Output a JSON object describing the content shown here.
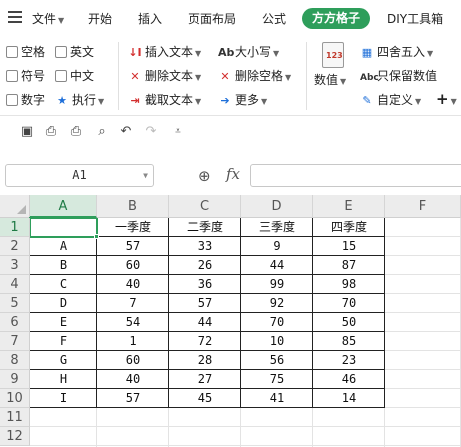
{
  "menu": {
    "file": "文件",
    "items": [
      "开始",
      "插入",
      "页面布局",
      "公式",
      "方方格子",
      "DIY工具箱"
    ]
  },
  "ribbon": {
    "checkboxes": [
      "空格",
      "英文",
      "符号",
      "中文",
      "数字"
    ],
    "execute": "执行",
    "text_tools": [
      "插入文本",
      "删除文本",
      "截取文本"
    ],
    "case_tools": [
      "大小写",
      "删除空格",
      "更多"
    ],
    "numeric": "数值",
    "round_tools": [
      "四舍五入",
      "只保留数值",
      "自定义"
    ],
    "plus": "+"
  },
  "formula_bar": {
    "cell_ref": "A1",
    "fx": "fx",
    "formula": ""
  },
  "grid": {
    "columns": [
      "A",
      "B",
      "C",
      "D",
      "E",
      "F"
    ],
    "rows": [
      "1",
      "2",
      "3",
      "4",
      "5",
      "6",
      "7",
      "8",
      "9",
      "10",
      "11",
      "12"
    ],
    "header_row": [
      "",
      "一季度",
      "二季度",
      "三季度",
      "四季度"
    ],
    "data": [
      [
        "A",
        "57",
        "33",
        "9",
        "15"
      ],
      [
        "B",
        "60",
        "26",
        "44",
        "87"
      ],
      [
        "C",
        "40",
        "36",
        "99",
        "98"
      ],
      [
        "D",
        "7",
        "57",
        "92",
        "70"
      ],
      [
        "E",
        "54",
        "44",
        "70",
        "50"
      ],
      [
        "F",
        "1",
        "72",
        "10",
        "85"
      ],
      [
        "G",
        "60",
        "28",
        "56",
        "23"
      ],
      [
        "H",
        "40",
        "27",
        "75",
        "46"
      ],
      [
        "I",
        "57",
        "45",
        "41",
        "14"
      ]
    ]
  },
  "colors": {
    "accent": "#2e9e5b",
    "header_bg": "#ececec"
  }
}
